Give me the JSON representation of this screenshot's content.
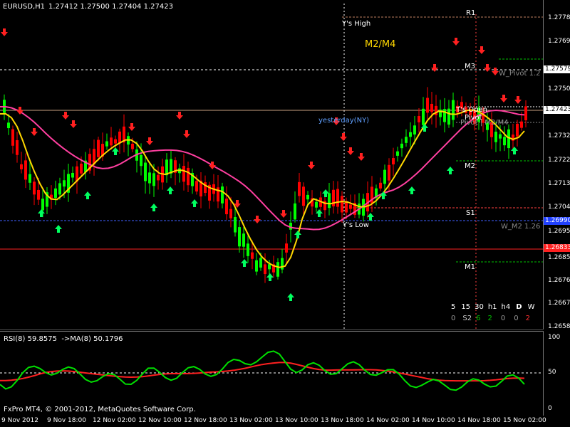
{
  "header": {
    "symbol_tf": "EURUSD,H1",
    "ohlc": "1.27412 1.27500 1.27404 1.27423"
  },
  "main_annotations": {
    "ys_high": "Y's High",
    "ys_low": "Y's Low",
    "m2m4": "M2/M4",
    "yesterday": "yesterday(NY)",
    "ts_open": "T's Open",
    "pivot": "Pivot",
    "pivot_m2m4": "Pivot | M2/M4",
    "r1": "R1",
    "m3": "M3",
    "m2": "M2",
    "s1": "S1",
    "m1": "M1",
    "w_pivot": "W_Pivot 1.2",
    "w_m2": "W_M2 1.26"
  },
  "price_axis": {
    "ticks": [
      "1.27780",
      "1.27690",
      "1.27505",
      "1.27410",
      "1.27320",
      "1.27225",
      "1.27135",
      "1.27040",
      "1.26950",
      "1.26855",
      "1.26765",
      "1.26670",
      "1.26580"
    ],
    "current_price": "1.27423",
    "m3_marker": "1.27579",
    "s1_marker": "1.26990",
    "red_marker": "1.26833"
  },
  "timeframes": {
    "labels": [
      "5",
      "15",
      "30",
      "h1",
      "h4",
      "D",
      "W"
    ],
    "values": [
      "0",
      "S2",
      "6",
      "2",
      "0",
      "0",
      "2"
    ]
  },
  "rsi": {
    "title": "RSI(8) 59.8575",
    "ma_label": "->MA(8) 50.1796",
    "ticks": [
      "100",
      "50",
      "0"
    ],
    "copyright": "FxPro MT4, © 2001-2012, MetaQuotes Software Corp."
  },
  "time_axis": {
    "labels": [
      "9 Nov 2012",
      "9 Nov 18:00",
      "12 Nov 02:00",
      "12 Nov 10:00",
      "12 Nov 18:00",
      "13 Nov 02:00",
      "13 Nov 10:00",
      "13 Nov 18:00",
      "14 Nov 02:00",
      "14 Nov 10:00",
      "14 Nov 18:00",
      "15 Nov 02:00"
    ]
  },
  "colors": {
    "bull": "#00ff00",
    "bear": "#ff0000",
    "ma_fast": "#ffd700",
    "ma_slow": "#ff3fa0",
    "pivot_white": "#ffffff",
    "level_red": "#ff3333",
    "rsi_green": "#00e000",
    "rsi_red": "#ff2020"
  }
}
